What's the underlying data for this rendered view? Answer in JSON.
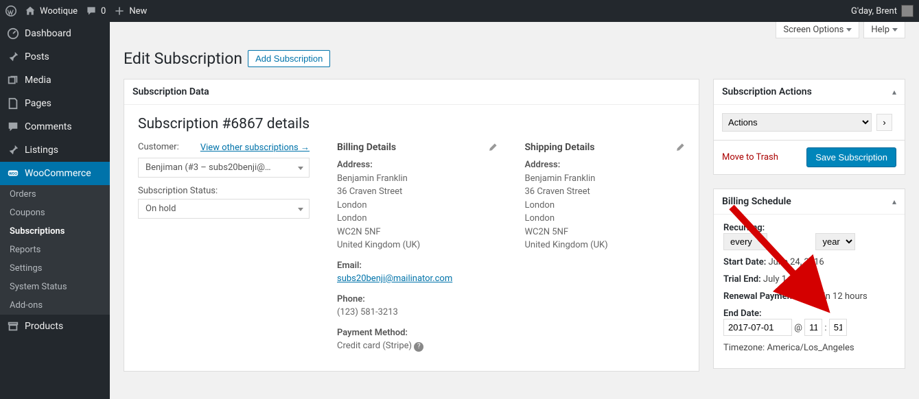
{
  "adminbar": {
    "site_name": "Wootique",
    "comments_count": "0",
    "new_label": "New",
    "greeting": "G'day, Brent"
  },
  "sidebar": {
    "dashboard": "Dashboard",
    "posts": "Posts",
    "media": "Media",
    "pages": "Pages",
    "comments": "Comments",
    "listings": "Listings",
    "woocommerce": "WooCommerce",
    "products": "Products",
    "woo_sub": {
      "orders": "Orders",
      "coupons": "Coupons",
      "subscriptions": "Subscriptions",
      "reports": "Reports",
      "settings": "Settings",
      "system_status": "System Status",
      "addons": "Add-ons"
    }
  },
  "top_right": {
    "screen_options": "Screen Options",
    "help": "Help"
  },
  "page": {
    "title": "Edit Subscription",
    "add_btn": "Add Subscription"
  },
  "subdata": {
    "box_title": "Subscription Data",
    "heading": "Subscription #6867 details",
    "customer_label": "Customer:",
    "view_other": "View other subscriptions →",
    "customer_value": "Benjiman (#3 – subs20benji@…",
    "status_label": "Subscription Status:",
    "status_value": "On hold",
    "billing": {
      "title": "Billing Details",
      "addr_label": "Address:",
      "name": "Benjamin Franklin",
      "line1": "36 Craven Street",
      "line2": "London",
      "line3": "London",
      "line4": "WC2N 5NF",
      "line5": "United Kingdom (UK)",
      "email_label": "Email:",
      "email": "subs20benji@mailinator.com",
      "phone_label": "Phone:",
      "phone": "(123) 581-3213",
      "pmethod_label": "Payment Method:",
      "pmethod": "Credit card (Stripe)"
    },
    "shipping": {
      "title": "Shipping Details",
      "addr_label": "Address:",
      "name": "Benjamin Franklin",
      "line1": "36 Craven Street",
      "line2": "London",
      "line3": "London",
      "line4": "WC2N 5NF",
      "line5": "United Kingdom (UK)"
    }
  },
  "actions_box": {
    "title": "Subscription Actions",
    "select_value": "Actions",
    "trash": "Move to Trash",
    "save": "Save Subscription"
  },
  "billing_box": {
    "title": "Billing Schedule",
    "recurring_label": "Recurring:",
    "freq": "every",
    "unit": "year",
    "start_label": "Start Date:",
    "start_value": "June 24, 2016",
    "trial_label": "Trial End:",
    "trial_value": "July 1, 2016",
    "retry_label": "Renewal Payment Retry:",
    "retry_value": "In 12 hours",
    "end_label": "End Date:",
    "end_date": "2017-07-01",
    "end_hh": "11",
    "end_mm": "51",
    "tz_label": "Timezone:",
    "tz_value": "America/Los_Angeles"
  }
}
